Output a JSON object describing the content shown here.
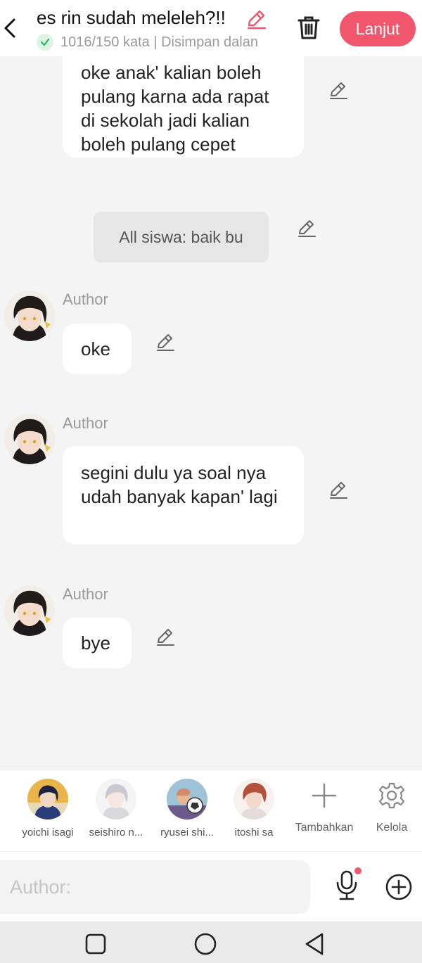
{
  "header": {
    "title": "es rin sudah meleleh?!!",
    "status": "1016/150 kata | Disimpan dalan",
    "next_label": "Lanjut",
    "icons": [
      "back-arrow-icon",
      "pencil-icon",
      "check-icon",
      "trash-icon"
    ],
    "accent_color": "#f2566c"
  },
  "messages": [
    {
      "type": "bubble",
      "text": "oke anak' kalian boleh pulang karna ada rapat di sekolah jadi kalian boleh pulang cepet"
    },
    {
      "type": "narration",
      "text": "All siswa: baik bu"
    },
    {
      "type": "bubble",
      "author": "Author",
      "text": "oke"
    },
    {
      "type": "bubble",
      "author": "Author",
      "text": "segini dulu ya soal nya udah banyak kapan' lagi"
    },
    {
      "type": "bubble",
      "author": "Author",
      "text": "bye"
    }
  ],
  "characters": [
    {
      "name": "yoichi isagi"
    },
    {
      "name": "seishiro n..."
    },
    {
      "name": "ryusei shi..."
    },
    {
      "name": "itoshi sa"
    }
  ],
  "tools": {
    "add_label": "Tambahkan",
    "manage_label": "Kelola"
  },
  "composer": {
    "placeholder": "Author:",
    "icons": [
      "microphone-icon",
      "plus-circle-icon"
    ],
    "mic_dot_color": "#f2566c"
  },
  "system_nav": {
    "icons": [
      "recents-icon",
      "home-icon",
      "back-icon"
    ]
  }
}
